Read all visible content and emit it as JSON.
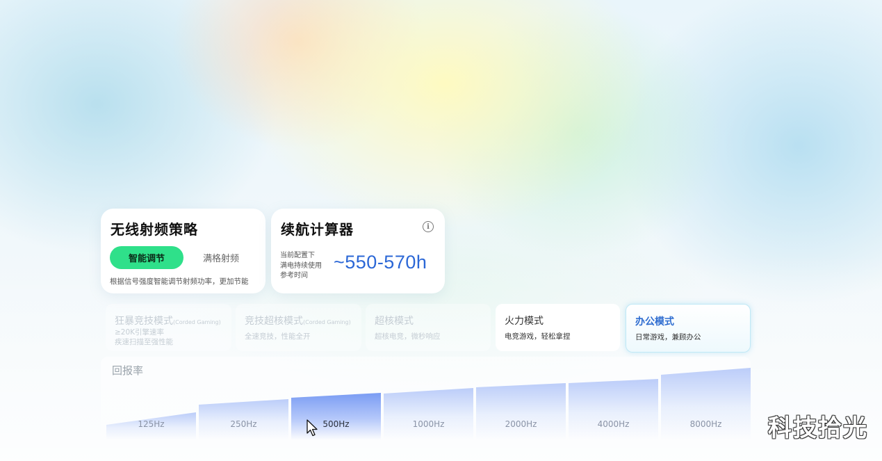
{
  "rf_strategy": {
    "title": "无线射频策略",
    "options": [
      "智能调节",
      "满格射频"
    ],
    "selected": "智能调节",
    "description": "根据信号强度智能调节射频功率，更加节能"
  },
  "battery_calc": {
    "title": "续航计算器",
    "info_icon": "info-icon",
    "caption_lines": [
      "当前配置下",
      "满电持续使用",
      "参考时间"
    ],
    "value": "~550-570h"
  },
  "modes": [
    {
      "title": "狂暴竞技模式",
      "tag": "(Corded Gaming)",
      "sub": [
        "≥20K引擎速率",
        "疾速扫描至强性能"
      ],
      "state": "disabled"
    },
    {
      "title": "竞技超核模式",
      "tag": "(Corded Gaming)",
      "sub": [
        "全速竞技，性能全开"
      ],
      "state": "disabled"
    },
    {
      "title": "超核模式",
      "tag": "",
      "sub": [
        "超核电竞，微秒响应"
      ],
      "state": "disabled"
    },
    {
      "title": "火力模式",
      "tag": "",
      "sub": [
        "电竞游戏，轻松拿捏"
      ],
      "state": "enabled"
    },
    {
      "title": "办公模式",
      "tag": "",
      "sub": [
        "日常游戏，兼顾办公"
      ],
      "state": "selected"
    }
  ],
  "polling_rate": {
    "title": "回报率",
    "options": [
      "125Hz",
      "250Hz",
      "500Hz",
      "1000Hz",
      "2000Hz",
      "4000Hz",
      "8000Hz"
    ],
    "selected": "500Hz"
  },
  "watermark": "科技拾光",
  "colors": {
    "accent_green": "#2fe08a",
    "accent_blue": "#2b67d6",
    "selected_bar": "#7a9cf3"
  }
}
